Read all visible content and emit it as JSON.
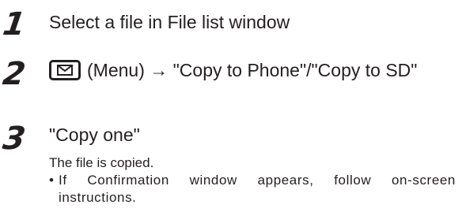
{
  "steps": [
    {
      "number": "1",
      "text": "Select a file in File list window"
    },
    {
      "number": "2",
      "key_icon": "mail-envelope-key-icon",
      "text": "(Menu) → \"Copy to Phone\"/\"Copy to SD\""
    },
    {
      "number": "3",
      "text": "\"Copy one\"",
      "note": "The file is copied.",
      "bullet_mark": "•",
      "bullet": "If Confirmation window appears, follow on-screen instructions."
    }
  ]
}
